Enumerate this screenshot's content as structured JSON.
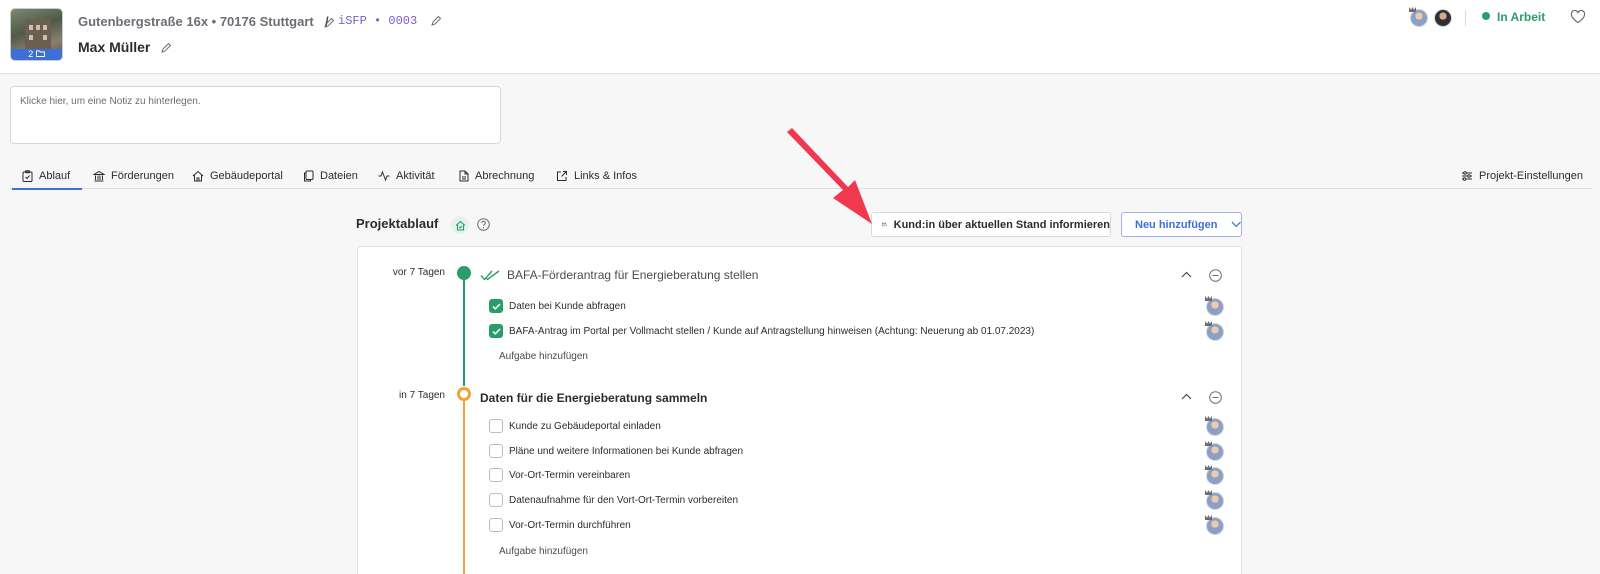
{
  "header": {
    "photo_count": "2",
    "address": "Gutenbergstraße 16x • 70176 Stuttgart",
    "separator": "/",
    "project_code": "iSFP • 0003",
    "customer_name": "Max Müller",
    "status": "In Arbeit",
    "status_color": "#2b9d6a"
  },
  "note": {
    "placeholder": "Klicke hier, um eine Notiz zu hinterlegen."
  },
  "tabs": [
    {
      "label": "Ablauf",
      "icon": "clipboard-icon",
      "active": true
    },
    {
      "label": "Förderungen",
      "icon": "bank-icon"
    },
    {
      "label": "Gebäudeportal",
      "icon": "house-icon"
    },
    {
      "label": "Dateien",
      "icon": "files-icon"
    },
    {
      "label": "Aktivität",
      "icon": "activity-icon"
    },
    {
      "label": "Abrechnung",
      "icon": "invoice-icon"
    },
    {
      "label": "Links & Infos",
      "icon": "external-link-icon"
    }
  ],
  "settings_label": "Projekt-Einstellungen",
  "timeline": {
    "title": "Projektablauf",
    "inform_button": "Kund:in über aktuellen Stand informieren",
    "new_button": "Neu hinzufügen",
    "add_task_label": "Aufgabe hinzufügen",
    "sections": [
      {
        "when": "vor 7 Tagen",
        "title": "BAFA-Förderantrag für Energieberatung stellen",
        "status": "done",
        "tasks": [
          {
            "label": "Daten bei Kunde abfragen",
            "checked": true
          },
          {
            "label": "BAFA-Antrag im Portal per Vollmacht stellen / Kunde auf Antragstellung hinweisen (Achtung: Neuerung ab 01.07.2023)",
            "checked": true
          }
        ]
      },
      {
        "when": "in 7 Tagen",
        "title": "Daten für die Energieberatung sammeln",
        "status": "open",
        "tasks": [
          {
            "label": "Kunde zu Gebäudeportal einladen",
            "checked": false
          },
          {
            "label": "Pläne und weitere Informationen bei Kunde abfragen",
            "checked": false
          },
          {
            "label": "Vor-Ort-Termin vereinbaren",
            "checked": false
          },
          {
            "label": "Datenaufnahme für den Vort-Ort-Termin vorbereiten",
            "checked": false
          },
          {
            "label": "Vor-Ort-Termin durchführen",
            "checked": false
          }
        ]
      }
    ]
  },
  "colors": {
    "accent": "#3d6fd6",
    "done": "#2b9d6a",
    "open": "#f0a23a",
    "annotation_arrow": "#f0384f"
  }
}
